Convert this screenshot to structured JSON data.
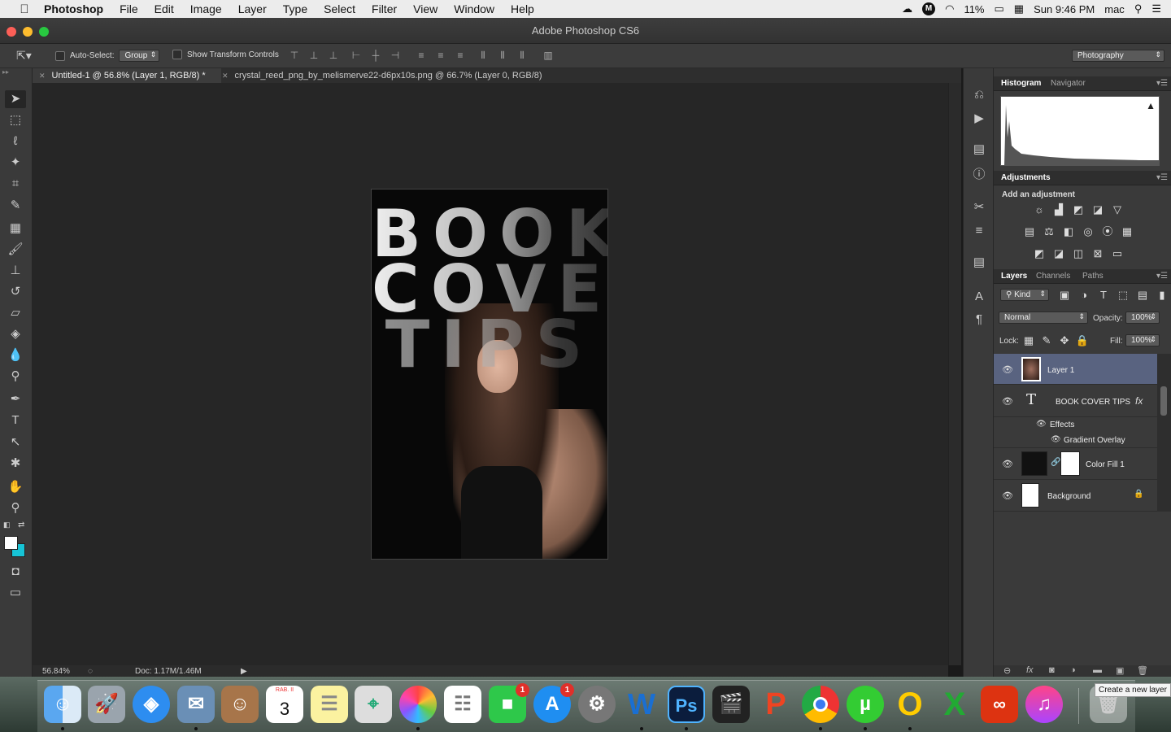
{
  "menubar": {
    "apple": "",
    "app": "Photoshop",
    "items": [
      "File",
      "Edit",
      "Image",
      "Layer",
      "Type",
      "Select",
      "Filter",
      "View",
      "Window",
      "Help"
    ],
    "battery": "11%",
    "clock": "Sun 9:46 PM",
    "user": "mac"
  },
  "window": {
    "title": "Adobe Photoshop CS6"
  },
  "options": {
    "auto_select_label": "Auto-Select:",
    "auto_select_value": "Group",
    "transform_label": "Show Transform Controls",
    "workspace": "Photography"
  },
  "tabs": [
    {
      "label": "Untitled-1 @ 56.8% (Layer 1, RGB/8) *"
    },
    {
      "label": "crystal_reed_png_by_melismerve22-d6px10s.png @ 66.7% (Layer 0, RGB/8)"
    }
  ],
  "document": {
    "line1": "BOOK",
    "line2": "COVER",
    "line3": "TIPS"
  },
  "status": {
    "zoom": "56.84%",
    "doc": "Doc: 1.17M/1.46M"
  },
  "panels": {
    "histogram_tab": "Histogram",
    "navigator_tab": "Navigator",
    "adjustments_tab": "Adjustments",
    "add_adjustment": "Add an adjustment",
    "layers_tab": "Layers",
    "channels_tab": "Channels",
    "paths_tab": "Paths",
    "kind": "Kind",
    "blend": "Normal",
    "opacity_label": "Opacity:",
    "opacity": "100%",
    "lock_label": "Lock:",
    "fill_label": "Fill:",
    "fill": "100%"
  },
  "layers": [
    {
      "name": "Layer 1"
    },
    {
      "name": "BOOK COVER TIPS"
    },
    {
      "name": "Effects"
    },
    {
      "name": "Gradient Overlay"
    },
    {
      "name": "Color Fill 1"
    },
    {
      "name": "Background"
    }
  ],
  "dock": {
    "calendar_month": "RAB. II",
    "calendar_day": "3",
    "facetime_badge": "1",
    "appstore_badge": "1",
    "tooltip": "Create a new layer"
  }
}
